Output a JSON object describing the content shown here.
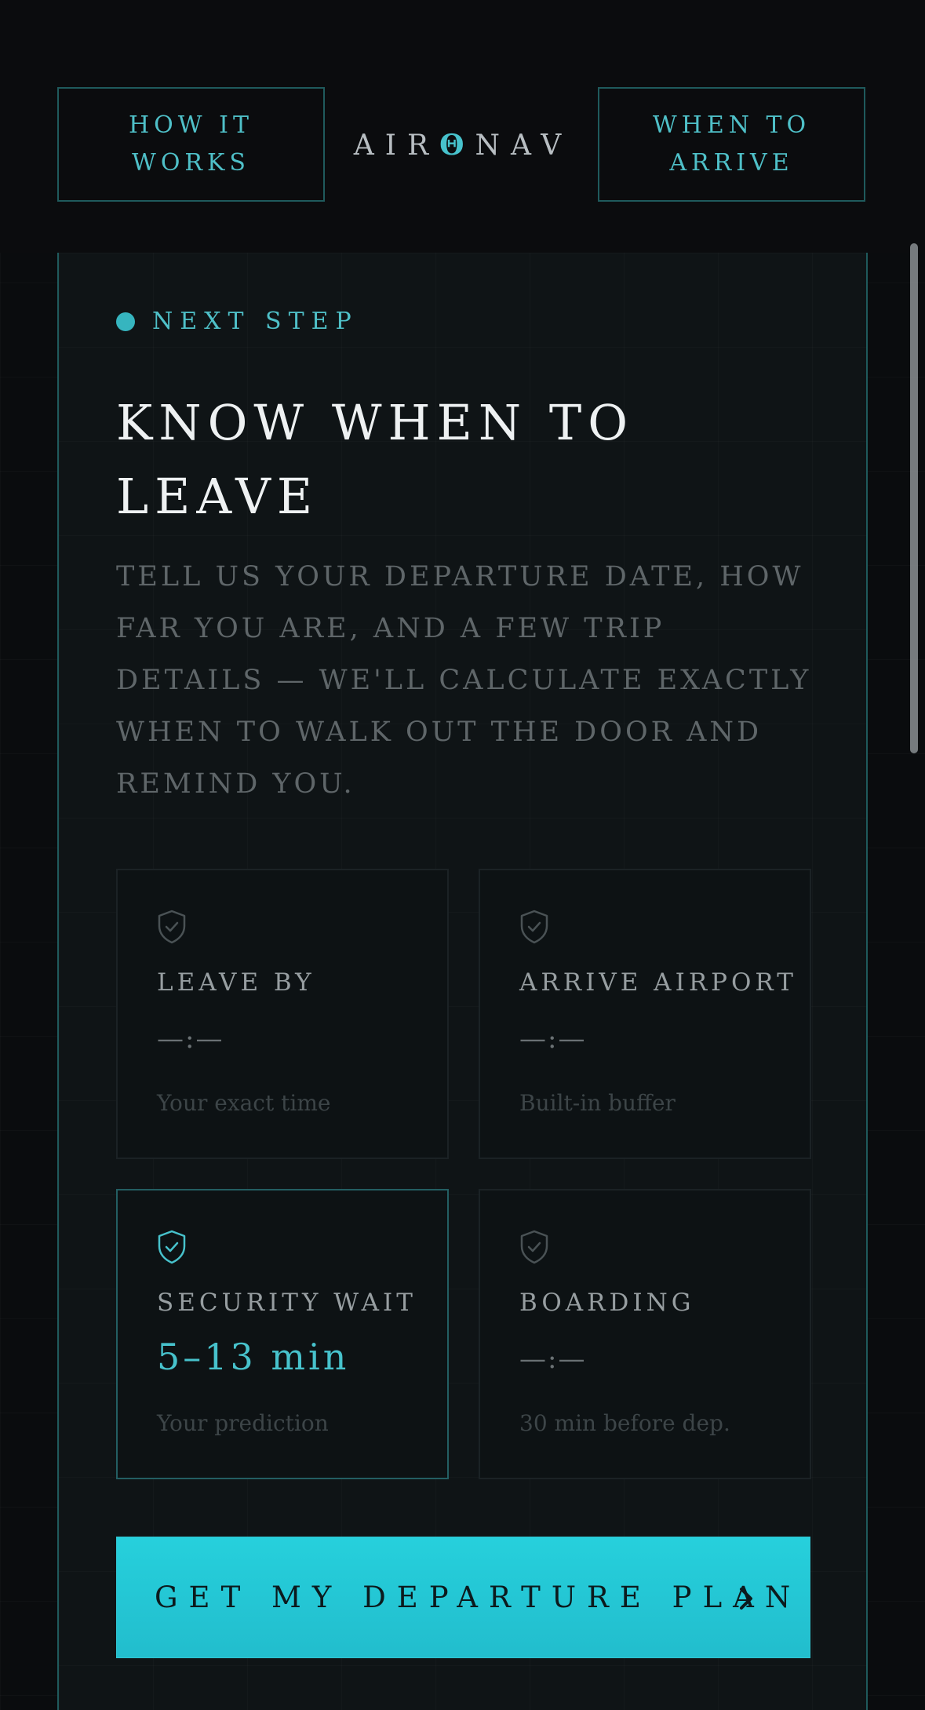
{
  "header": {
    "nav_left_label": "HOW IT WORKS",
    "logo_left": "AIR",
    "logo_mark": "Θ",
    "logo_right": "NAV",
    "nav_right_label": "WHEN TO ARRIVE"
  },
  "card": {
    "eyebrow": "NEXT STEP",
    "title": "KNOW WHEN TO LEAVE",
    "description": "TELL US YOUR DEPARTURE DATE, HOW FAR YOU ARE, AND A FEW TRIP DETAILS — WE'LL CALCULATE EXACTLY WHEN TO WALK OUT THE DOOR AND REMIND YOU."
  },
  "tiles": [
    {
      "label": "LEAVE BY",
      "value": "—:—",
      "sub": "Your exact time",
      "icon": "shield-check-icon",
      "active": false
    },
    {
      "label": "ARRIVE AIRPORT",
      "value": "—:—",
      "sub": "Built-in buffer",
      "icon": "shield-check-icon",
      "active": false
    },
    {
      "label": "SECURITY WAIT",
      "value": "5–13 min",
      "sub": "Your prediction",
      "icon": "shield-check-icon",
      "active": true
    },
    {
      "label": "BOARDING",
      "value": "—:—",
      "sub": "30 min before dep.",
      "icon": "shield-check-icon",
      "active": false
    }
  ],
  "cta": {
    "label": "GET MY DEPARTURE PLAN",
    "icon": "chevron-right-icon"
  },
  "colors": {
    "accent": "#26d0dc",
    "accent_text": "#4fc0c8",
    "background": "#0a0c0e",
    "card": "#0f1416",
    "border": "#1f5a5c"
  }
}
